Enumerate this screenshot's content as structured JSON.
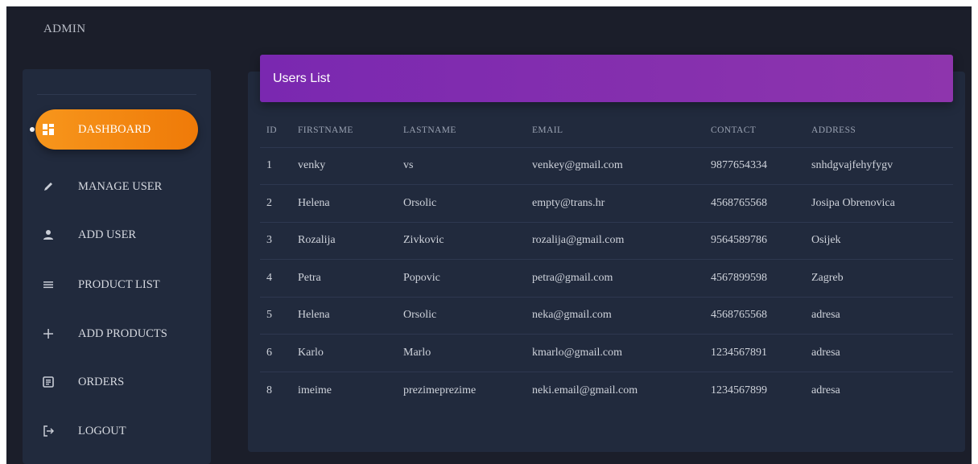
{
  "brand": "ADMIN",
  "sidebar": {
    "items": [
      {
        "label": "DASHBOARD",
        "icon": "dashboard-icon",
        "active": true
      },
      {
        "label": "MANAGE USER",
        "icon": "pencil-icon"
      },
      {
        "label": "ADD USER",
        "icon": "person-icon"
      },
      {
        "label": "PRODUCT LIST",
        "icon": "list-icon"
      },
      {
        "label": "ADD PRODUCTS",
        "icon": "plus-icon"
      },
      {
        "label": "ORDERS",
        "icon": "orders-icon"
      },
      {
        "label": "LOGOUT",
        "icon": "logout-icon"
      }
    ]
  },
  "users": {
    "title": "Users List",
    "columns": [
      "ID",
      "FIRSTNAME",
      "LASTNAME",
      "EMAIL",
      "CONTACT",
      "ADDRESS"
    ],
    "rows": [
      [
        "1",
        "venky",
        "vs",
        "venkey@gmail.com",
        "9877654334",
        "snhdgvajfehyfygv"
      ],
      [
        "2",
        "Helena",
        "Orsolic",
        "empty@trans.hr",
        "4568765568",
        "Josipa Obrenovica"
      ],
      [
        "3",
        "Rozalija",
        "Zivkovic",
        "rozalija@gmail.com",
        "9564589786",
        "Osijek"
      ],
      [
        "4",
        "Petra",
        "Popovic",
        "petra@gmail.com",
        "4567899598",
        "Zagreb"
      ],
      [
        "5",
        "Helena",
        "Orsolic",
        "neka@gmail.com",
        "4568765568",
        "adresa"
      ],
      [
        "6",
        "Karlo",
        "Marlo",
        "kmarlo@gmail.com",
        "1234567891",
        "adresa"
      ],
      [
        "8",
        "imeime",
        "prezimeprezime",
        "neki.email@gmail.com",
        "1234567899",
        "adresa"
      ]
    ]
  },
  "colors": {
    "background": "#1b1e2a",
    "panel": "#212a3d",
    "active_gradient_start": "#f7961c",
    "active_gradient_end": "#ef7a08",
    "header_gradient_start": "#7a28b0",
    "header_gradient_end": "#8e35ad"
  }
}
